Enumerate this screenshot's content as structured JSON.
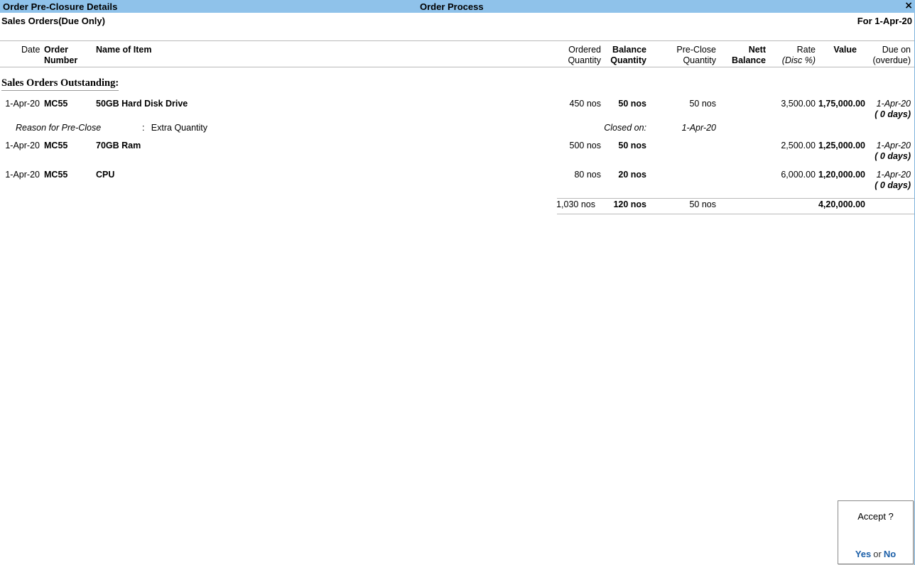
{
  "window": {
    "title": "Order Pre-Closure Details",
    "center_title": "Order Process",
    "close_icon": "×",
    "titlebar_color": "#8fc2ea"
  },
  "report": {
    "name": "Sales Orders(Due Only)",
    "period": "For 1-Apr-20"
  },
  "columns": {
    "date": "Date",
    "order_number_l1": "Order",
    "order_number_l2": "Number",
    "name_of_item": "Name of Item",
    "ordered_qty_l1": "Ordered",
    "ordered_qty_l2": "Quantity",
    "balance_qty_l1": "Balance",
    "balance_qty_l2": "Quantity",
    "preclose_qty_l1": "Pre-Close",
    "preclose_qty_l2": "Quantity",
    "nett_balance_l1": "Nett",
    "nett_balance_l2": "Balance",
    "rate_l1": "Rate",
    "rate_l2": "(Disc %)",
    "value": "Value",
    "due_on_l1": "Due on",
    "due_on_l2": "(overdue)"
  },
  "group_title": "Sales Orders Outstanding:",
  "rows": [
    {
      "date": "1-Apr-20",
      "order_number": "MC55",
      "item": "50GB Hard Disk Drive",
      "ordered_qty": "450 nos",
      "balance_qty": "50 nos",
      "preclose_qty": "50 nos",
      "nett_balance": "",
      "rate": "3,500.00",
      "value": "1,75,000.00",
      "due_on": "1-Apr-20",
      "overdue": "( 0 days)",
      "reason_label": "Reason for Pre-Close",
      "reason_separator": ":",
      "reason_value": "Extra Quantity",
      "closed_on_label": "Closed on:",
      "closed_on_value": "1-Apr-20"
    },
    {
      "date": "1-Apr-20",
      "order_number": "MC55",
      "item": "70GB Ram",
      "ordered_qty": "500 nos",
      "balance_qty": "50 nos",
      "preclose_qty": "",
      "nett_balance": "",
      "rate": "2,500.00",
      "value": "1,25,000.00",
      "due_on": "1-Apr-20",
      "overdue": "( 0 days)"
    },
    {
      "date": "1-Apr-20",
      "order_number": "MC55",
      "item": "CPU",
      "ordered_qty": "80 nos",
      "balance_qty": "20 nos",
      "preclose_qty": "",
      "nett_balance": "",
      "rate": "6,000.00",
      "value": "1,20,000.00",
      "due_on": "1-Apr-20",
      "overdue": "( 0 days)"
    }
  ],
  "totals": {
    "ordered_qty": "1,030 nos",
    "balance_qty": "120 nos",
    "preclose_qty": "50 nos",
    "nett_balance": "",
    "rate": "",
    "value": "4,20,000.00",
    "due_on": ""
  },
  "accept_dialog": {
    "prompt": "Accept ?",
    "yes": "Yes",
    "or": "or",
    "no": "No",
    "link_color": "#1b5fa8"
  }
}
